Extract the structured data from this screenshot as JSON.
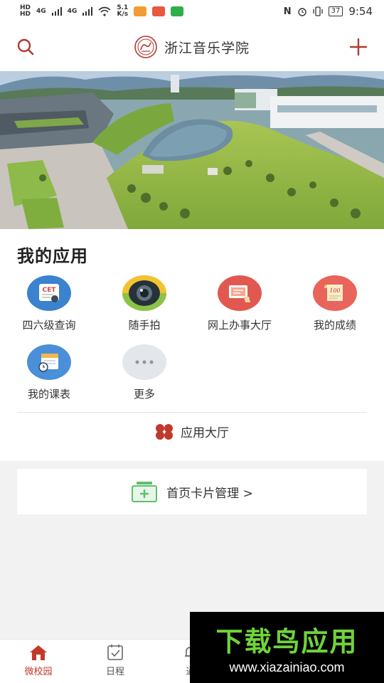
{
  "status_bar": {
    "network_top": "HD",
    "network_bottom": "HD",
    "signal1": "4G",
    "signal2": "4G",
    "speed": "5.1",
    "speed_unit": "K/s",
    "battery": "37",
    "time": "9:54"
  },
  "header": {
    "title": "浙江音乐学院",
    "search_icon": "search-icon",
    "add_icon": "plus-icon",
    "accent_color": "#b03a2e"
  },
  "apps": {
    "title": "我的应用",
    "items": [
      {
        "label": "四六级查询",
        "icon": "cet-icon"
      },
      {
        "label": "随手拍",
        "icon": "camera-icon"
      },
      {
        "label": "网上办事大厅",
        "icon": "online-service-icon"
      },
      {
        "label": "我的成绩",
        "icon": "grades-icon"
      },
      {
        "label": "我的课表",
        "icon": "schedule-icon"
      },
      {
        "label": "更多",
        "icon": "more-icon"
      }
    ],
    "hall_label": "应用大厅"
  },
  "card_manage": {
    "label": "首页卡片管理 >"
  },
  "bottom_nav": {
    "items": [
      {
        "label": "微校园",
        "active": true
      },
      {
        "label": "日程",
        "active": false
      },
      {
        "label": "通",
        "active": false
      }
    ]
  },
  "watermark": {
    "title": "下载鸟应用",
    "url": "www.xiazainiao.com"
  }
}
